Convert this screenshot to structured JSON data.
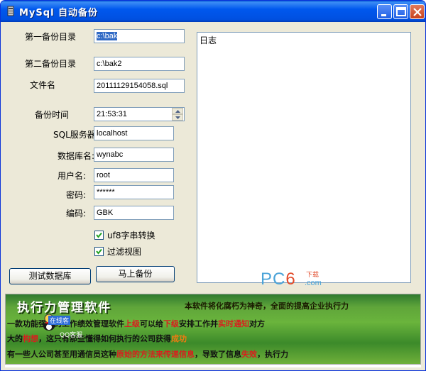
{
  "window": {
    "title": "MySql 自动备份",
    "controls": [
      "minimize-icon",
      "maximize-icon",
      "close-icon"
    ],
    "accent_color": "#0054e3"
  },
  "form": {
    "backup_dir1": {
      "label": "第一备份目录",
      "value": "c:\\bak"
    },
    "backup_dir2": {
      "label": "第二备份目录",
      "value": "c:\\bak2"
    },
    "filename": {
      "label": "文件名",
      "value": "20111129154058.sql"
    },
    "backup_time": {
      "label": "备份时间",
      "value": "21:53:31"
    },
    "sql_server": {
      "label": "SQL服务器:",
      "value": "localhost"
    },
    "database": {
      "label": "数据库名:",
      "value": "wynabc"
    },
    "username": {
      "label": "用户名:",
      "value": "root"
    },
    "password": {
      "label": "密码:",
      "value": "******"
    },
    "encoding": {
      "label": "编码:",
      "value": "GBK"
    },
    "utf8_convert": {
      "label": "uf8字串转换",
      "checked": true
    },
    "filter_views": {
      "label": "过滤视图",
      "checked": true
    }
  },
  "buttons": {
    "test_db": "测试数据库",
    "backup_now": "马上备份"
  },
  "log": {
    "title": "日志"
  },
  "watermark": {
    "pc": "PC",
    "six": "6",
    "sub": "下载",
    "com": ".com"
  },
  "banner": {
    "title": "执行力管理软件",
    "slogan": "本软件将化腐朽为神奇，全面的提高企业执行力",
    "line1_a": "一款功能强大的工作绩效管理软件",
    "line1_b": "上级",
    "line1_c": "可以给",
    "line1_d": "下级",
    "line1_e": "安排工作并",
    "line1_f": "实时通知",
    "line1_g": "对方",
    "line2_a": "大的",
    "line2_b": "构想",
    "line2_c": "，这只有那些懂得如何执行的公司获得",
    "line2_d": "成功",
    "line3_a": "有一些人公司甚至用通信员这种",
    "line3_b": "原始的方法来传递信息",
    "line3_c": "，导致了信息",
    "line3_d": "失效",
    "line3_e": "，执行力",
    "qq_tag": "在线客",
    "qq_num": "QQ客服"
  }
}
